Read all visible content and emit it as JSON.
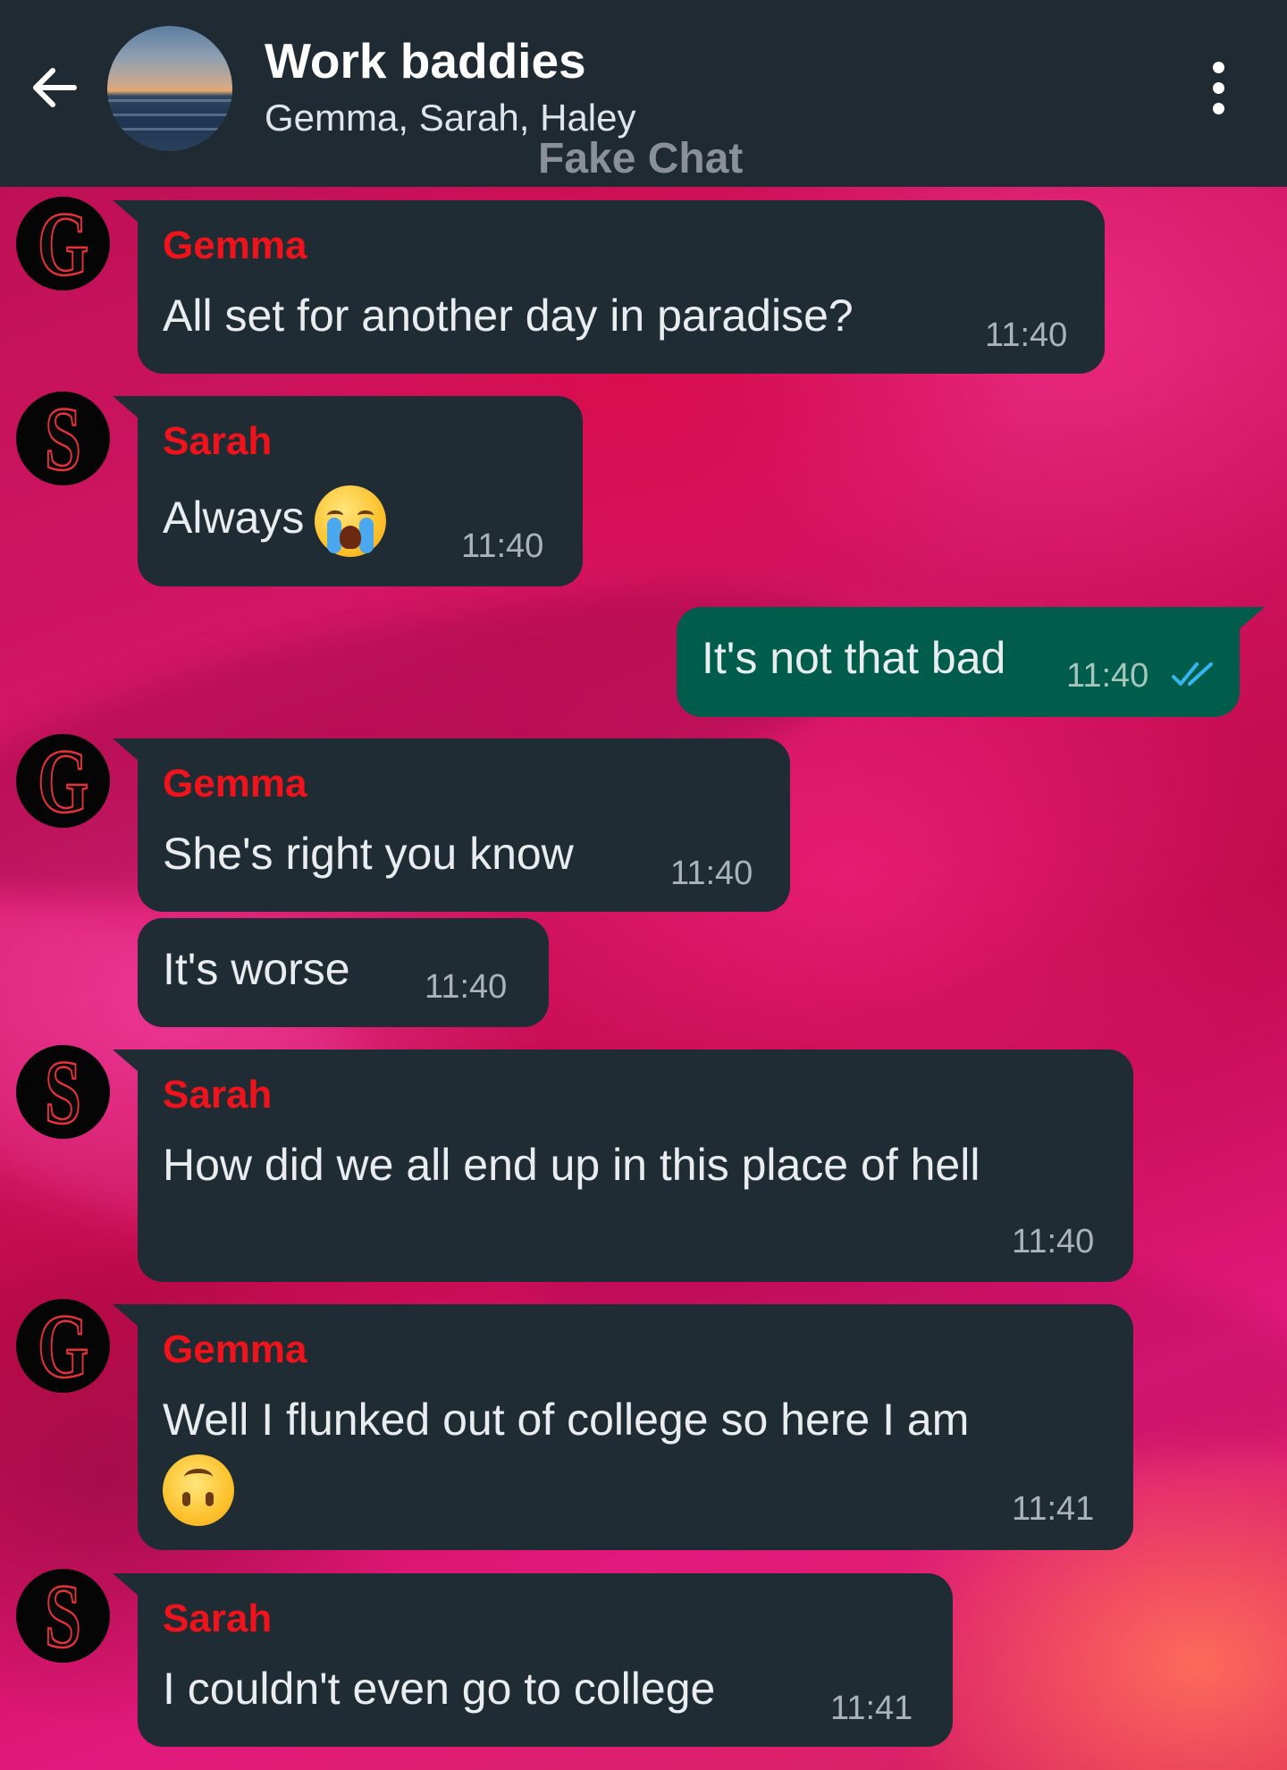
{
  "header": {
    "title": "Work baddies",
    "subtitle": "Gemma, Sarah, Haley",
    "watermark": "Fake Chat",
    "icons": {
      "back": "arrow-left-icon",
      "menu": "more-vertical-icon"
    }
  },
  "colors": {
    "header_bg": "#1f2a32",
    "incoming_bubble": "#202c34",
    "outgoing_bubble": "#005c4b",
    "sender_name": "#f0131c",
    "read_ticks": "#34b7f1"
  },
  "messages": [
    {
      "sender": "Gemma",
      "initial": "G",
      "text": "All set for another day in paradise?",
      "time": "11:40"
    },
    {
      "sender": "Sarah",
      "initial": "S",
      "text": "Always",
      "emoji": "loudly-crying-face",
      "time": "11:40"
    },
    {
      "sender": "me",
      "text": "It's not that bad",
      "time": "11:40",
      "status": "read"
    },
    {
      "sender": "Gemma",
      "initial": "G",
      "text": "She's right you know",
      "time": "11:40"
    },
    {
      "sender": "Gemma",
      "text": "It's worse",
      "time": "11:40"
    },
    {
      "sender": "Sarah",
      "initial": "S",
      "text": "How did we all end up in this place of hell",
      "time": "11:40"
    },
    {
      "sender": "Gemma",
      "initial": "G",
      "text": "Well I flunked out of college so here I am",
      "emoji": "upside-down-face",
      "time": "11:41"
    },
    {
      "sender": "Sarah",
      "initial": "S",
      "text": "I couldn't even go to college",
      "time": "11:41"
    }
  ]
}
